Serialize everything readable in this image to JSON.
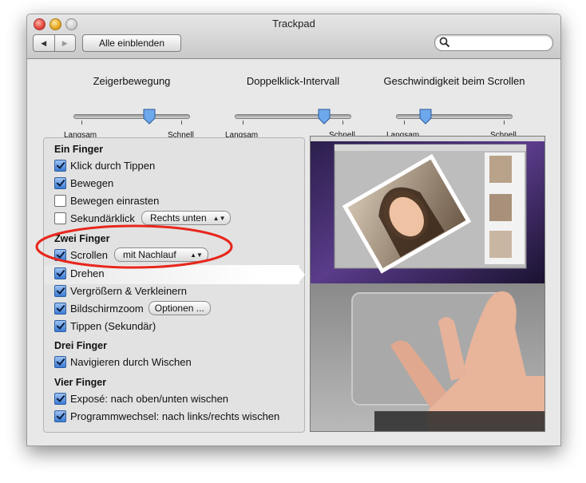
{
  "window": {
    "title": "Trackpad"
  },
  "toolbar": {
    "back_glyph": "◀",
    "forward_glyph": "▶",
    "show_all_label": "Alle einblenden",
    "search_value": "",
    "search_icon": "search-icon"
  },
  "sliders": [
    {
      "title": "Zeigerbewegung",
      "min_label": "Langsam",
      "max_label": "Schnell",
      "value": 0.62
    },
    {
      "title": "Doppelklick-Intervall",
      "min_label": "Langsam",
      "max_label": "Schnell",
      "value": 0.77
    },
    {
      "title": "Geschwindigkeit beim Scrollen",
      "min_label": "Langsam",
      "max_label": "Schnell",
      "value": 0.25
    }
  ],
  "sections": {
    "one": {
      "title": "Ein Finger",
      "tap": {
        "label": "Klick durch Tippen",
        "checked": true
      },
      "drag": {
        "label": "Bewegen",
        "checked": true
      },
      "draglock": {
        "label": "Bewegen einrasten",
        "checked": false
      },
      "secondary": {
        "label": "Sekundärklick",
        "checked": false,
        "popup": "Rechts unten"
      }
    },
    "two": {
      "title": "Zwei Finger",
      "scroll": {
        "label": "Scrollen",
        "checked": true,
        "popup": "mit Nachlauf"
      },
      "rotate": {
        "label": "Drehen",
        "checked": true
      },
      "zoom": {
        "label": "Vergrößern & Verkleinern",
        "checked": true
      },
      "screenzoom": {
        "label": "Bildschirmzoom",
        "checked": true,
        "button": "Optionen ..."
      },
      "tap": {
        "label": "Tippen (Sekundär)",
        "checked": true
      }
    },
    "three": {
      "title": "Drei Finger",
      "swipe": {
        "label": "Navigieren durch Wischen",
        "checked": true
      }
    },
    "four": {
      "title": "Vier Finger",
      "expose": {
        "label": "Exposé: nach oben/unten wischen",
        "checked": true
      },
      "appswitch": {
        "label": "Programmwechsel: nach links/rechts wischen",
        "checked": true
      }
    }
  },
  "colors": {
    "accent": "#3a7bd5",
    "annotation_ring": "#e8261c",
    "window_bg": "#e8e8e8"
  }
}
